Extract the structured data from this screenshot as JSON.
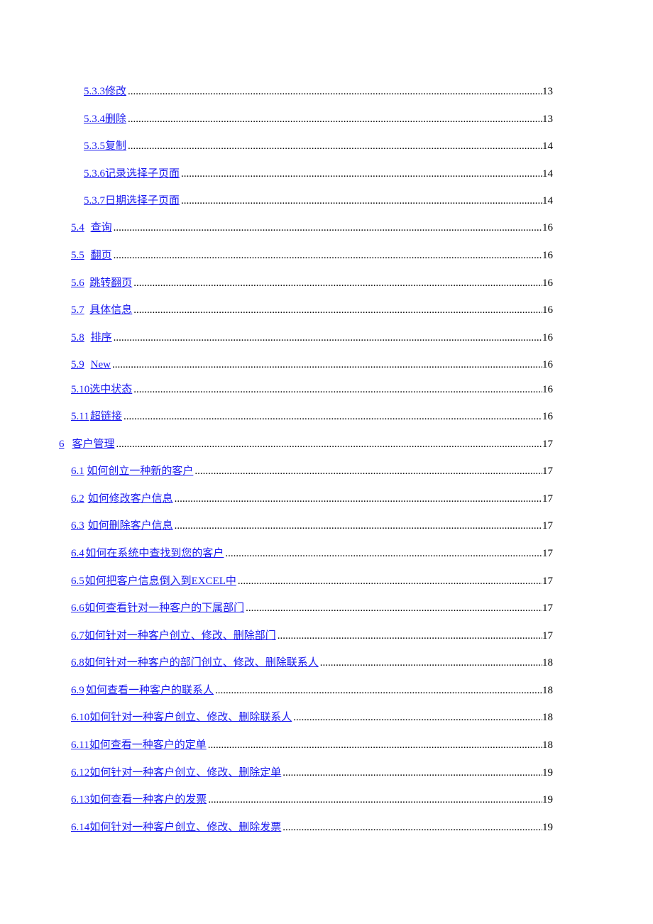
{
  "toc": {
    "entries": [
      {
        "num": "5.3.3",
        "title": "修改",
        "page": "13",
        "level": 3
      },
      {
        "num": "5.3.4",
        "title": "删除",
        "page": "13",
        "level": 3
      },
      {
        "num": "5.3.5",
        "title": "复制",
        "page": "14",
        "level": 3
      },
      {
        "num": "5.3.6",
        "title": "记录选择子页面",
        "page": "14",
        "level": 3
      },
      {
        "num": "5.3.7",
        "title": "日期选择子页面",
        "page": "14",
        "level": 3
      },
      {
        "num": "5.4",
        "title": "查询",
        "page": "16",
        "level": 2
      },
      {
        "num": "5.5",
        "title": "翻页",
        "page": "16",
        "level": 2
      },
      {
        "num": "5.6",
        "title": "跳转翻页",
        "page": "16",
        "level": 2
      },
      {
        "num": "5.7",
        "title": "具体信息",
        "page": "16",
        "level": 2
      },
      {
        "num": "5.8",
        "title": "排序",
        "page": "16",
        "level": 2
      },
      {
        "num": "5.9",
        "title": "New",
        "page": "16",
        "level": 2
      },
      {
        "num": "5.10",
        "title": "选中状态",
        "page": "16",
        "level": 2
      },
      {
        "num": "5.11",
        "title": "超链接",
        "page": "16",
        "level": 2
      },
      {
        "num": "6",
        "title": "客户管理",
        "page": "17",
        "level": 1
      },
      {
        "num": "6.1",
        "title": "如何创立一种新的客户",
        "page": "17",
        "level": 2
      },
      {
        "num": "6.2",
        "title": "如何修改客户信息",
        "page": "17",
        "level": 2
      },
      {
        "num": "6.3",
        "title": "如何删除客户信息",
        "page": "17",
        "level": 2
      },
      {
        "num": "6.4",
        "title": "如何在系统中查找到您的客户",
        "page": "17",
        "level": 2
      },
      {
        "num": "6.5",
        "title": "如何把客户信息倒入到EXCEL中",
        "page": "17",
        "level": 2
      },
      {
        "num": "6.6",
        "title": "如何查看针对一种客户的下属部门",
        "page": "17",
        "level": 2
      },
      {
        "num": "6.7",
        "title": "如何针对一种客户创立、修改、删除部门",
        "page": "17",
        "level": 2
      },
      {
        "num": "6.8",
        "title": "如何针对一种客户的部门创立、修改、删除联系人",
        "page": "18",
        "level": 2
      },
      {
        "num": "6.9",
        "title": "如何查看一种客户的联系人",
        "page": "18",
        "level": 2
      },
      {
        "num": "6.10",
        "title": "如何针对一种客户创立、修改、删除联系人",
        "page": "18",
        "level": 2
      },
      {
        "num": "6.11",
        "title": "如何查看一种客户的定单",
        "page": "18",
        "level": 2
      },
      {
        "num": "6.12",
        "title": "如何针对一种客户创立、修改、删除定单",
        "page": "19",
        "level": 2
      },
      {
        "num": "6.13",
        "title": "如何查看一种客户的发票",
        "page": "19",
        "level": 2
      },
      {
        "num": "6.14",
        "title": "如何针对一种客户创立、修改、删除发票",
        "page": "19",
        "level": 2
      }
    ]
  },
  "colors": {
    "link": "#1a1aee",
    "text": "#000000"
  }
}
